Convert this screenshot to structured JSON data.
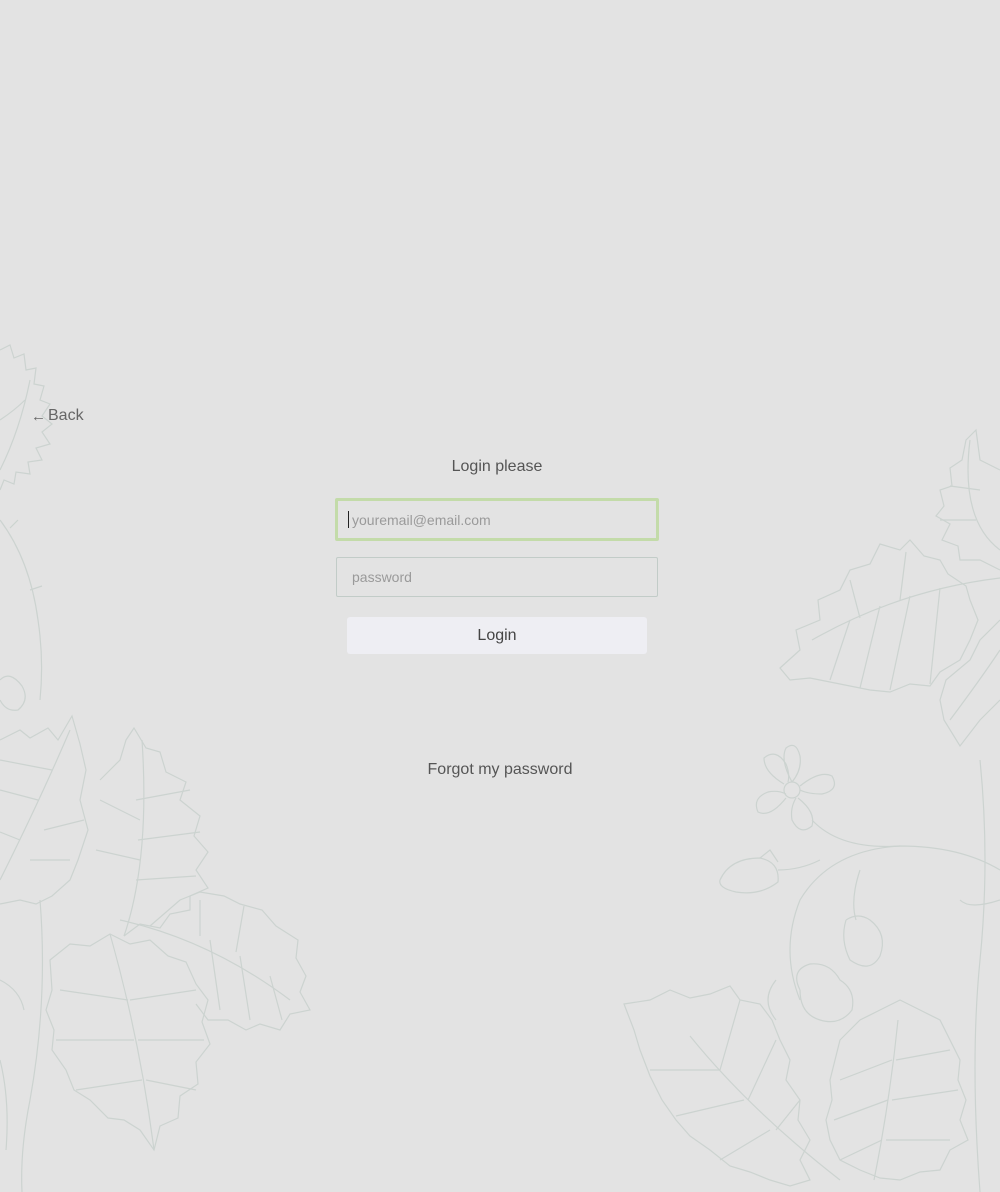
{
  "nav": {
    "back_arrow": "←",
    "back_label": "Back"
  },
  "login": {
    "title": "Login please",
    "email_placeholder": "youremail@email.com",
    "password_placeholder": "password",
    "submit_label": "Login",
    "forgot_label": "Forgot my password"
  },
  "theme": {
    "background": "#e3e3e3",
    "focus_border": "#c3dba9",
    "field_border": "#c2ccc8",
    "button_bg": "#eeeef3",
    "line_art": "#cfd6d3"
  }
}
